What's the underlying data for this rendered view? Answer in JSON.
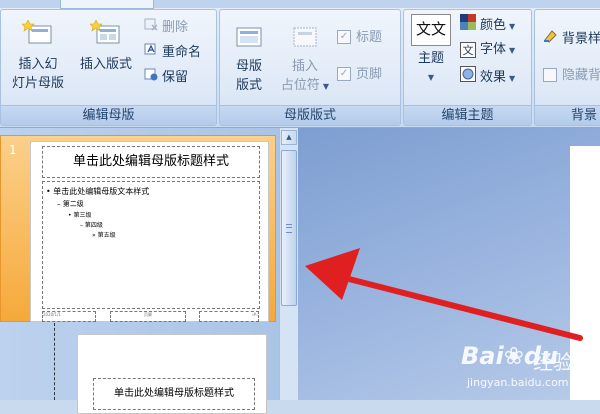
{
  "ribbon": {
    "groups": {
      "edit_master": {
        "label": "编辑母版",
        "insert_slide_master": "插入幻\n灯片母版",
        "insert_slide_master_line1": "插入幻",
        "insert_slide_master_line2": "灯片母版",
        "insert_layout": "插入版式",
        "delete": "删除",
        "rename": "重命名",
        "preserve": "保留"
      },
      "master_layout": {
        "label": "母版版式",
        "master_layout_line1": "母版",
        "master_layout_line2": "版式",
        "insert_placeholder_line1": "插入",
        "insert_placeholder_line2": "占位符",
        "title_check": "标题",
        "footer_check": "页脚"
      },
      "edit_theme": {
        "label": "编辑主题",
        "themes": "主题",
        "colors": "颜色",
        "fonts": "字体",
        "effects": "效果",
        "theme_icon_text": "文文"
      },
      "background": {
        "label": "背景",
        "background_styles": "背景样",
        "hide_background": "隐藏背"
      }
    }
  },
  "slides_panel": {
    "slide_number": "1",
    "slide1": {
      "title": "单击此处编辑母版标题样式",
      "body_levels": [
        "• 单击此处编辑母版文本样式",
        "– 第二级",
        "• 第三级",
        "– 第四级",
        "» 第五级"
      ],
      "footer_left": "2020/1/1",
      "footer_center": "页脚",
      "footer_right": "‹#›"
    },
    "slide2": {
      "title": "单击此处编辑母版标题样式"
    }
  },
  "watermark": {
    "brand": "Bai",
    "brand_suffix": "du",
    "cn": "经验",
    "url": "jingyan.baidu.com"
  },
  "colors": {
    "arrow": "#e02020",
    "selection": "#f6a93a",
    "ribbon_text": "#1e395b"
  }
}
